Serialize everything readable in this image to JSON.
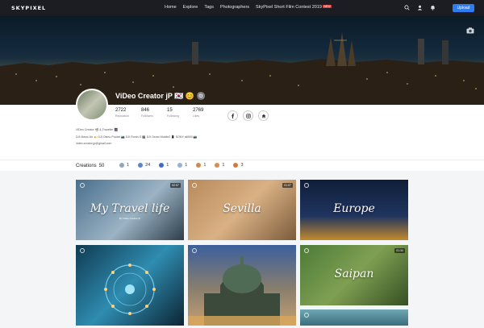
{
  "nav": {
    "logo": "SKYPIXEL",
    "links": [
      "Home",
      "Explore",
      "Tags",
      "Photographers",
      "SkyPixel Short Film Contest 2019"
    ],
    "new_badge": "NEW",
    "upload_label": "Upload"
  },
  "profile": {
    "username": "ViDeo Creator jP 🇰🇷 😊 🔘",
    "stats": [
      {
        "value": "2722",
        "label": "Reputation"
      },
      {
        "value": "846",
        "label": "Followers"
      },
      {
        "value": "15",
        "label": "Following"
      },
      {
        "value": "2769",
        "label": "Likes"
      }
    ],
    "bio_lines": [
      "ViDeo Creator 📽 & Traveller 🌉",
      "DJI Mavic Air 🚁 DJI Osmo Pocket 📷 DJI Ronin-S 🎬 DJI Osmo Mobile2 📱 SONY a6500 📷",
      "video.creator.jp@gmail.com"
    ]
  },
  "creations": {
    "label": "Creations",
    "count": "50",
    "badges": [
      {
        "count": "1",
        "color": "#8fa6bf"
      },
      {
        "count": "24",
        "color": "#5b86c9"
      },
      {
        "count": "1",
        "color": "#3d6ec4"
      },
      {
        "count": "1",
        "color": "#93b4d4"
      },
      {
        "count": "1",
        "color": "#d08a4e"
      },
      {
        "count": "1",
        "color": "#d98a55"
      },
      {
        "count": "3",
        "color": "#d4793d"
      }
    ]
  },
  "cards": [
    {
      "title": "My Travel life",
      "subtitle": "By Video Creator jP",
      "duration": "02:57",
      "bg": "linear-gradient(135deg,#4a6f8c,#9bb3c4 55%,#2e3d4a)"
    },
    {
      "title": "Sevilla",
      "subtitle": "",
      "duration": "01:07",
      "bg": "linear-gradient(135deg,#b88a5b,#d9b184 50%,#7c5b3c)"
    },
    {
      "title": "Europe",
      "subtitle": "",
      "duration": "",
      "bg": "linear-gradient(180deg,#0f1e38,#1f3460 60%,#c28a2c)"
    },
    {
      "title": "",
      "subtitle": "",
      "duration": "",
      "bg": "linear-gradient(135deg,#103a52,#2f8cb0 50%,#0c2433)"
    },
    {
      "title": "",
      "subtitle": "",
      "duration": "",
      "bg": "linear-gradient(180deg,#3b5f9c,#8a7f6d 55%,#c4a073)"
    },
    {
      "title": "Saipan",
      "subtitle": "",
      "duration": "01:34",
      "bg": "linear-gradient(135deg,#4c7a38,#7fa052 50%,#344f24)"
    }
  ]
}
